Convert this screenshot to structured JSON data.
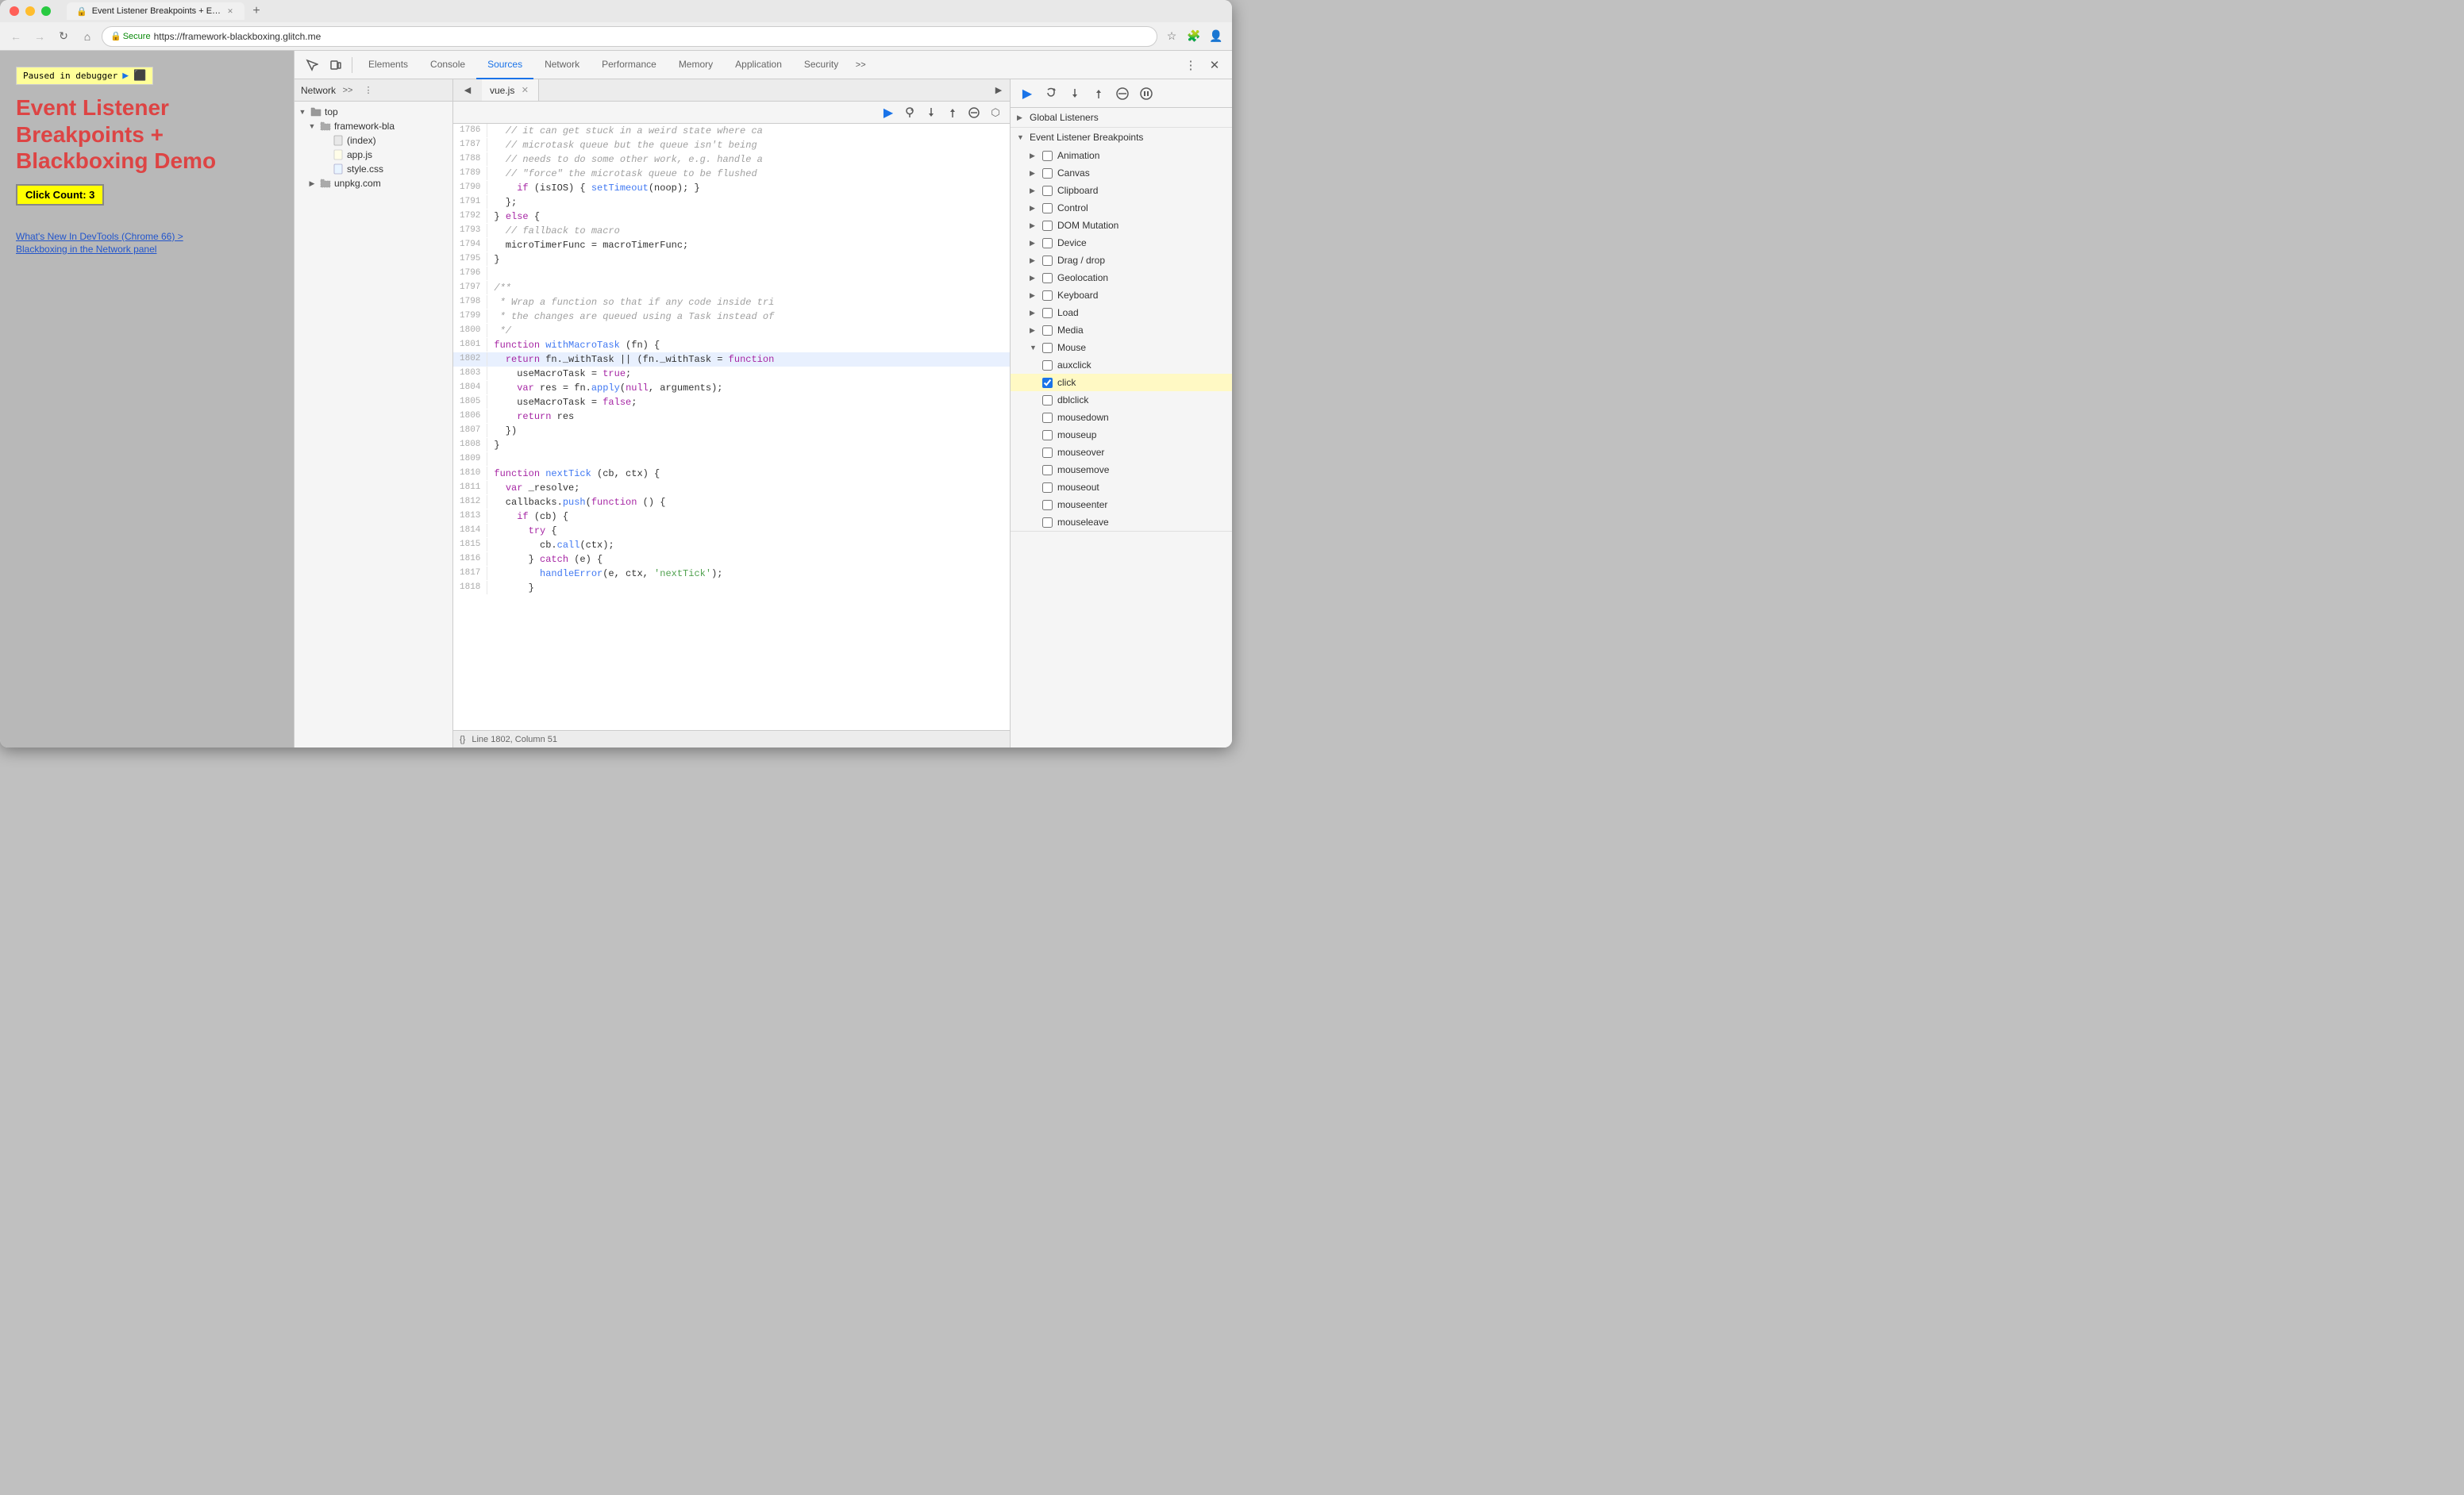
{
  "browser": {
    "tab_title": "Event Listener Breakpoints + E…",
    "tab_favicon": "🔒",
    "address": "https://framework-blackboxing.glitch.me",
    "secure_label": "Secure"
  },
  "page": {
    "debugger_banner": "Paused in debugger",
    "title_line1": "Event Listener",
    "title_line2": "Breakpoints +",
    "title_line3": "Blackboxing Demo",
    "click_count_label": "Click Count: 3",
    "link1": "What's New In DevTools (Chrome 66) >",
    "link2": "Blackboxing in the Network panel"
  },
  "devtools": {
    "tabs": [
      "Elements",
      "Console",
      "Sources",
      "Network",
      "Performance",
      "Memory",
      "Application",
      "Security"
    ],
    "active_tab": "Sources"
  },
  "sources_panel": {
    "network_label": "Network",
    "file_tree": {
      "top_label": "top",
      "framework_bla_label": "framework-bla",
      "index_label": "(index)",
      "app_js_label": "app.js",
      "style_css_label": "style.css",
      "unpkg_label": "unpkg.com"
    },
    "active_file": "vue.js"
  },
  "code": {
    "status_bar": "Line 1802, Column 51",
    "lines": [
      {
        "num": "1786",
        "content": "  // it can get stuck in a weird state where ca",
        "type": "comment"
      },
      {
        "num": "1787",
        "content": "  // microtask queue but the queue isn't being",
        "type": "comment"
      },
      {
        "num": "1788",
        "content": "  // needs to do some other work, e.g. handle a",
        "type": "comment"
      },
      {
        "num": "1789",
        "content": "  // \"force\" the microtask queue to be flushed",
        "type": "comment"
      },
      {
        "num": "1790",
        "content": "    if (isIOS) { setTimeout(noop); }",
        "type": "code"
      },
      {
        "num": "1791",
        "content": "  };",
        "type": "code"
      },
      {
        "num": "1792",
        "content": "} else {",
        "type": "code"
      },
      {
        "num": "1793",
        "content": "  // fallback to macro",
        "type": "comment"
      },
      {
        "num": "1794",
        "content": "  microTimerFunc = macroTimerFunc;",
        "type": "code"
      },
      {
        "num": "1795",
        "content": "}",
        "type": "code"
      },
      {
        "num": "1796",
        "content": "",
        "type": "empty"
      },
      {
        "num": "1797",
        "content": "/**",
        "type": "comment"
      },
      {
        "num": "1798",
        "content": " * Wrap a function so that if any code inside tri",
        "type": "comment"
      },
      {
        "num": "1799",
        "content": " * the changes are queued using a Task instead of",
        "type": "comment"
      },
      {
        "num": "1800",
        "content": " */",
        "type": "comment"
      },
      {
        "num": "1801",
        "content": "function withMacroTask (fn) {",
        "type": "code"
      },
      {
        "num": "1802",
        "content": "  return fn._withTask || (fn._withTask = function",
        "type": "active"
      },
      {
        "num": "1803",
        "content": "    useMacroTask = true;",
        "type": "code"
      },
      {
        "num": "1804",
        "content": "    var res = fn.apply(null, arguments);",
        "type": "code"
      },
      {
        "num": "1805",
        "content": "    useMacroTask = false;",
        "type": "code"
      },
      {
        "num": "1806",
        "content": "    return res",
        "type": "code"
      },
      {
        "num": "1807",
        "content": "  })",
        "type": "code"
      },
      {
        "num": "1808",
        "content": "}",
        "type": "code"
      },
      {
        "num": "1809",
        "content": "",
        "type": "empty"
      },
      {
        "num": "1810",
        "content": "function nextTick (cb, ctx) {",
        "type": "code"
      },
      {
        "num": "1811",
        "content": "  var _resolve;",
        "type": "code"
      },
      {
        "num": "1812",
        "content": "  callbacks.push(function () {",
        "type": "code"
      },
      {
        "num": "1813",
        "content": "    if (cb) {",
        "type": "code"
      },
      {
        "num": "1814",
        "content": "      try {",
        "type": "code"
      },
      {
        "num": "1815",
        "content": "        cb.call(ctx);",
        "type": "code"
      },
      {
        "num": "1816",
        "content": "      } catch (e) {",
        "type": "code"
      },
      {
        "num": "1817",
        "content": "        handleError(e, ctx, 'nextTick');",
        "type": "code"
      },
      {
        "num": "1818",
        "content": "      }",
        "type": "code"
      }
    ]
  },
  "breakpoints": {
    "debug_buttons": [
      "resume",
      "step-over",
      "step-into",
      "step-out",
      "deactivate",
      "pause"
    ],
    "global_listeners_label": "Global Listeners",
    "event_listener_label": "Event Listener Breakpoints",
    "categories": [
      {
        "label": "Animation",
        "expanded": false,
        "checked": false
      },
      {
        "label": "Canvas",
        "expanded": false,
        "checked": false
      },
      {
        "label": "Clipboard",
        "expanded": false,
        "checked": false
      },
      {
        "label": "Control",
        "expanded": false,
        "checked": false
      },
      {
        "label": "DOM Mutation",
        "expanded": false,
        "checked": false
      },
      {
        "label": "Device",
        "expanded": false,
        "checked": false
      },
      {
        "label": "Drag / drop",
        "expanded": false,
        "checked": false
      },
      {
        "label": "Geolocation",
        "expanded": false,
        "checked": false
      },
      {
        "label": "Keyboard",
        "expanded": false,
        "checked": false
      },
      {
        "label": "Load",
        "expanded": false,
        "checked": false
      },
      {
        "label": "Media",
        "expanded": false,
        "checked": false
      },
      {
        "label": "Mouse",
        "expanded": true,
        "checked": false
      }
    ],
    "mouse_items": [
      {
        "label": "auxclick",
        "checked": false
      },
      {
        "label": "click",
        "checked": true,
        "active": true
      },
      {
        "label": "dblclick",
        "checked": false
      },
      {
        "label": "mousedown",
        "checked": false
      },
      {
        "label": "mouseup",
        "checked": false
      },
      {
        "label": "mouseover",
        "checked": false
      },
      {
        "label": "mousemove",
        "checked": false
      },
      {
        "label": "mouseout",
        "checked": false
      },
      {
        "label": "mouseenter",
        "checked": false
      },
      {
        "label": "mouseleave",
        "checked": false
      }
    ]
  }
}
